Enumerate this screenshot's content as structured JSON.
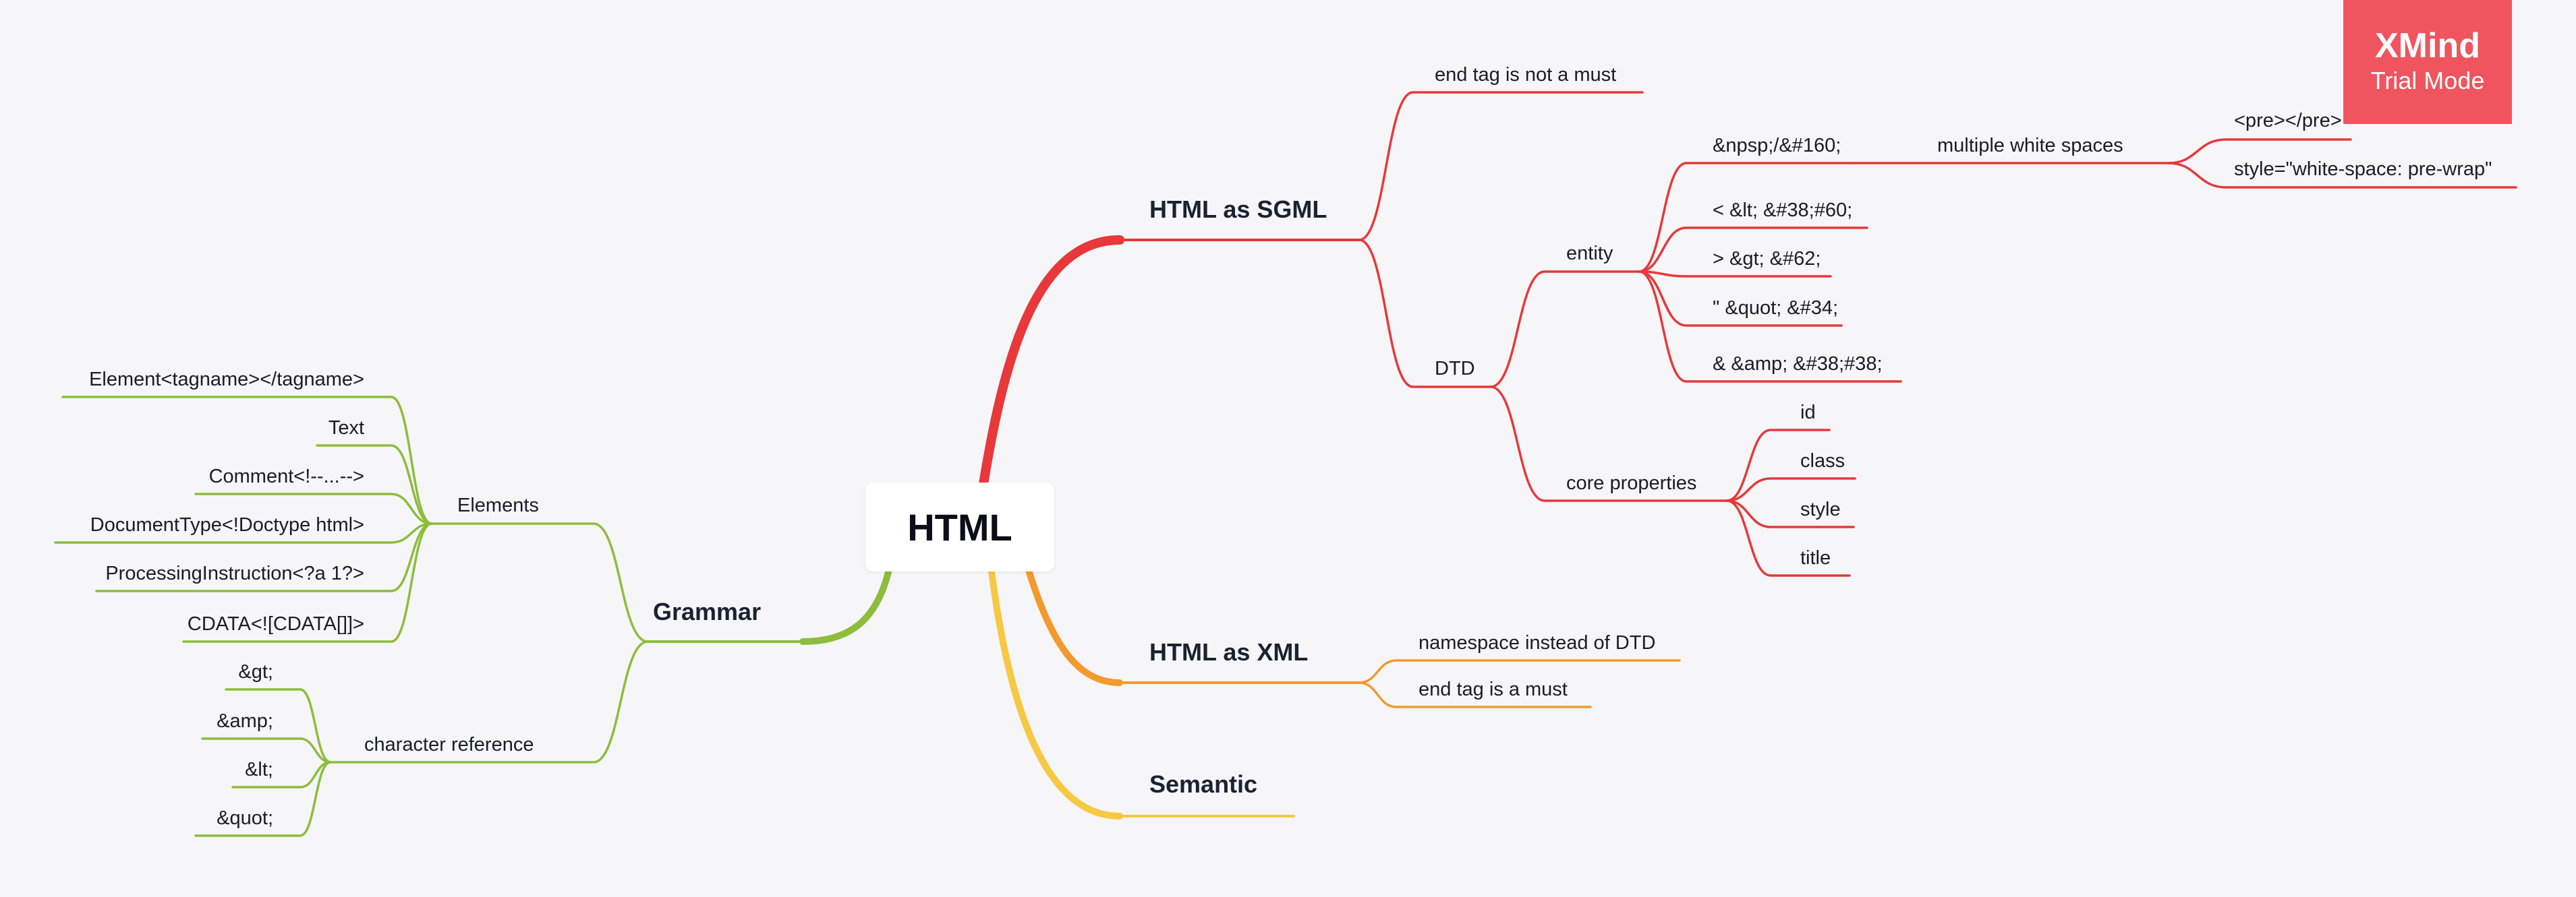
{
  "central": {
    "label": "HTML"
  },
  "watermark": {
    "title": "XMind",
    "subtitle": "Trial Mode"
  },
  "colors": {
    "red": "#e8383b",
    "orange": "#f39a2e",
    "yellow": "#f7c842",
    "green": "#8dbd3b",
    "background": "#f6f6f8",
    "badge": "#f0545e"
  },
  "branches": [
    {
      "label": "HTML as SGML",
      "color": "red",
      "children": [
        {
          "label": "end tag is not a must"
        },
        {
          "label": "DTD",
          "children": [
            {
              "label": "entity",
              "children": [
                {
                  "label": "&npsp;/&#160;",
                  "children": [
                    {
                      "label": "multiple white spaces",
                      "children": [
                        {
                          "label": "<pre></pre>"
                        },
                        {
                          "label": "style=\"white-space: pre-wrap\""
                        }
                      ]
                    }
                  ]
                },
                {
                  "label": "< &lt; &#38;#60;"
                },
                {
                  "label": "> &gt; &#62;"
                },
                {
                  "label": "\" &quot; &#34;"
                },
                {
                  "label": "& &amp; &#38;#38;"
                }
              ]
            },
            {
              "label": "core properties",
              "children": [
                {
                  "label": "id"
                },
                {
                  "label": "class"
                },
                {
                  "label": "style"
                },
                {
                  "label": "title"
                }
              ]
            }
          ]
        }
      ]
    },
    {
      "label": "HTML as XML",
      "color": "orange",
      "children": [
        {
          "label": "namespace instead of DTD"
        },
        {
          "label": "end tag is a must"
        }
      ]
    },
    {
      "label": "Semantic",
      "color": "yellow",
      "children": []
    },
    {
      "label": "Grammar",
      "color": "green",
      "children": [
        {
          "label": "Elements",
          "children": [
            {
              "label": "Element<tagname></tagname>"
            },
            {
              "label": "Text"
            },
            {
              "label": "Comment<!--...-->"
            },
            {
              "label": "DocumentType<!Doctype html>"
            },
            {
              "label": "ProcessingInstruction<?a 1?>"
            },
            {
              "label": "CDATA<![CDATA[]]>"
            }
          ]
        },
        {
          "label": "character reference",
          "children": [
            {
              "label": "&gt;"
            },
            {
              "label": "&amp;"
            },
            {
              "label": "&lt;"
            },
            {
              "label": "&quot;"
            }
          ]
        }
      ]
    }
  ]
}
